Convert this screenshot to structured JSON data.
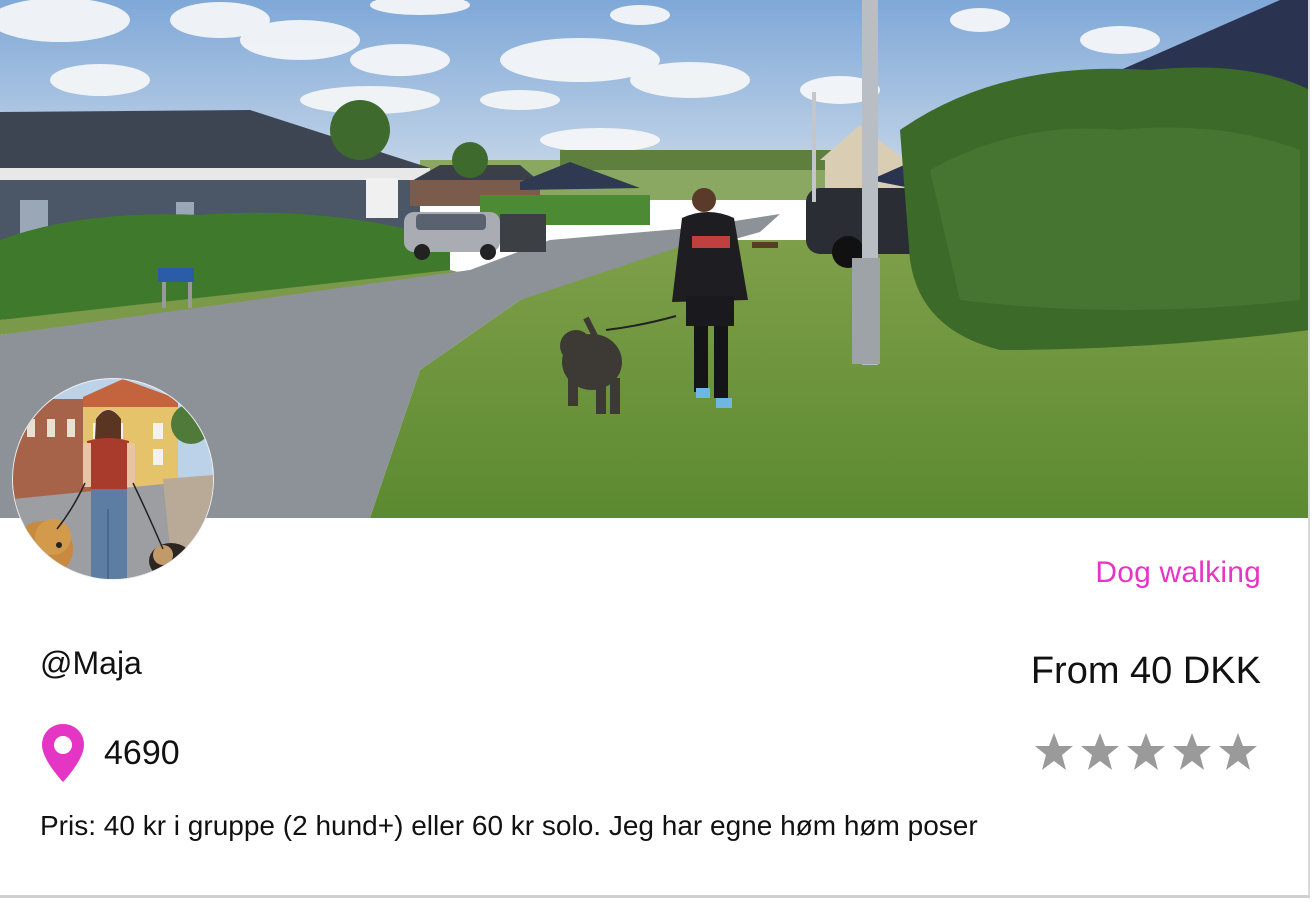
{
  "card": {
    "service_type": "Dog walking",
    "username": "@Maja",
    "price": "From 40 DKK",
    "location_zip": "4690",
    "rating": {
      "filled": 0,
      "max": 5
    },
    "description": "Pris: 40 kr i gruppe (2 hund+) eller 60 kr solo. Jeg har egne høm høm poser"
  },
  "icons": {
    "location": "map-pin-icon",
    "rating": "star-icon"
  },
  "colors": {
    "accent": "#e535c5",
    "text": "#111111",
    "star_empty": "#9a9a9a"
  }
}
